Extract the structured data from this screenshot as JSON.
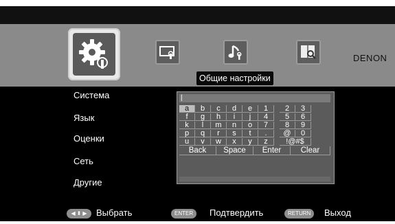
{
  "brand": "DENON",
  "menu": {
    "current_title": "Общие настройки",
    "icons": [
      "gear-wrench-icon",
      "display-wrench-icon",
      "music-note-icon",
      "book-magnifier-icon"
    ]
  },
  "sidebar": {
    "items": [
      {
        "label": "Система"
      },
      {
        "label": "Язык"
      },
      {
        "label": "Оценки"
      },
      {
        "label": "Сеть"
      },
      {
        "label": "Другие"
      }
    ]
  },
  "keyboard": {
    "input_value": "|",
    "rows": [
      {
        "left": [
          "a",
          "b",
          "c",
          "d",
          "e"
        ],
        "right": [
          "1",
          "2",
          "3"
        ]
      },
      {
        "left": [
          "f",
          "g",
          "h",
          "i",
          "j"
        ],
        "right": [
          "4",
          "5",
          "6"
        ]
      },
      {
        "left": [
          "k",
          "l",
          "m",
          "n",
          "o"
        ],
        "right": [
          "7",
          "8",
          "9"
        ]
      },
      {
        "left": [
          "p",
          "q",
          "r",
          "s",
          "t"
        ],
        "right": [
          ".",
          "@",
          "0"
        ]
      },
      {
        "left": [
          "u",
          "v",
          "w",
          "x",
          "y"
        ],
        "right": [
          "z",
          "!@#$"
        ]
      }
    ],
    "action_keys": [
      "Back",
      "Space",
      "Enter",
      "Clear"
    ],
    "selected_key": "a"
  },
  "footer": {
    "nav_hint": "Выбрать",
    "enter_button": "ENTER",
    "enter_hint": "Подтвердить",
    "return_button": "RETURN",
    "return_hint": "Выход"
  }
}
